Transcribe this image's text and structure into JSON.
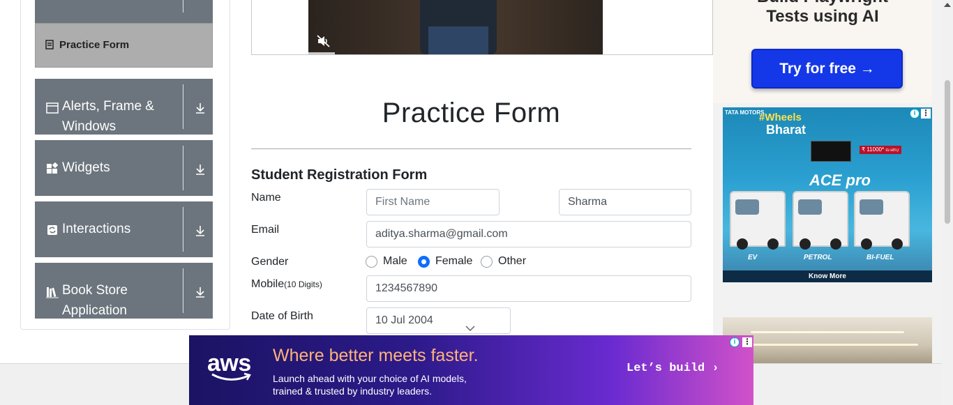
{
  "sidebar": {
    "active_item": "Practice Form",
    "menu_cards": [
      {
        "label_line1": "Alerts, Frame &",
        "label_line2": "Windows",
        "icon": "window-icon"
      },
      {
        "label_line1": "Widgets",
        "label_line2": "",
        "icon": "widgets-icon"
      },
      {
        "label_line1": "Interactions",
        "label_line2": "",
        "icon": "interactions-icon"
      },
      {
        "label_line1": "Book Store",
        "label_line2": "Application",
        "icon": "books-icon"
      }
    ]
  },
  "form": {
    "page_title": "Practice Form",
    "subtitle": "Student Registration Form",
    "name_label": "Name",
    "first_name_placeholder": "First Name",
    "last_name_value": "Sharma",
    "email_label": "Email",
    "email_value": "aditya.sharma@gmail.com",
    "gender_label": "Gender",
    "gender_options": [
      "Male",
      "Female",
      "Other"
    ],
    "gender_selected": "Female",
    "mobile_label": "Mobile",
    "mobile_hint": "(10 Digits)",
    "mobile_value": "1234567890",
    "dob_label": "Date of Birth",
    "dob_value": "10 Jul 2004"
  },
  "ads": {
    "top_ad": {
      "headline_line1": "Build Playwright",
      "headline_line2": "Tests using AI",
      "button": "Try for free →"
    },
    "tata_ad": {
      "brand": "TATA MOTORS",
      "campaign_line1": "#Wheels",
      "campaign_line2": "Bharat",
      "model": "ACE pro",
      "price": "₹ 11000* வரை",
      "fuel_types": [
        "EV",
        "PETROL",
        "BI-FUEL"
      ],
      "cta": "Know More"
    },
    "aws_ad": {
      "logo": "aws",
      "headline": "Where better meets faster.",
      "subline1": "Launch ahead with your choice of AI models,",
      "subline2": "trained & trusted by industry leaders.",
      "cta": "Let’s build ›"
    },
    "info_glyph": "i",
    "menu_glyph": "⋮"
  },
  "colors": {
    "sidebar_card": "#6c757d",
    "active_item": "#adadad",
    "radio_selected": "#0d6efd",
    "try_button": "#1437e8"
  }
}
